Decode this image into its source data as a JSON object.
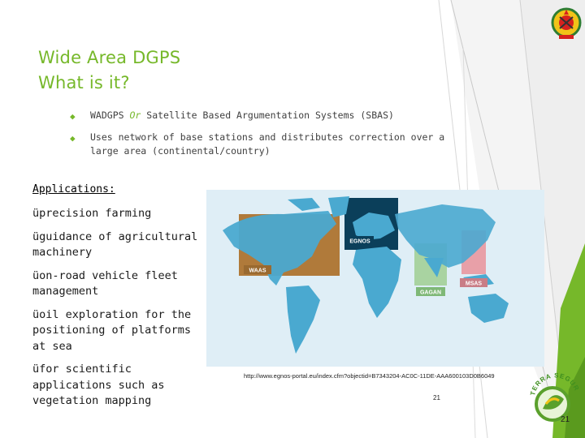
{
  "slide": {
    "title_line1": "Wide Area DGPS",
    "title_line2": "What is it?",
    "bullets": [
      {
        "prefix": "WADGPS",
        "or": "Or",
        "text": "Satellite Based Argumentation Systems (SBAS)"
      },
      {
        "text": "Uses network of base stations and distributes correction over a large area (continental/country)"
      }
    ],
    "applications_title": "Applications:",
    "applications": [
      "precision farming",
      "guidance of agricultural machinery",
      "on-road vehicle fleet management",
      "oil exploration for the positioning of platforms at sea",
      "for scientific applications such as vegetation mapping"
    ],
    "check_glyph": "ü",
    "map_labels": {
      "waas": "WAAS",
      "egnos": "EGNOS",
      "gagan": "GAGAN",
      "msas": "MSAS"
    },
    "source_url": "http://www.egnos-portal.eu/index.cfm?objectid=B7343204-AC0C-11DE-AAA600103D0B6049",
    "page_number": "21",
    "page_number_corner": "21",
    "logo_text": "TERRA SEGURA"
  },
  "colors": {
    "accent_green": "#76b82a",
    "ocean": "#dfeef6",
    "land": "#4aa9d0",
    "waas": "#b07a3a",
    "egnos": "#0b3f5a",
    "gagan": "#a9d3a1",
    "msas": "#e8a0a8"
  },
  "icons": [
    "diamond-bullet-icon",
    "checkmark-icon",
    "coat-of-arms-icon",
    "terra-segura-logo-icon"
  ]
}
